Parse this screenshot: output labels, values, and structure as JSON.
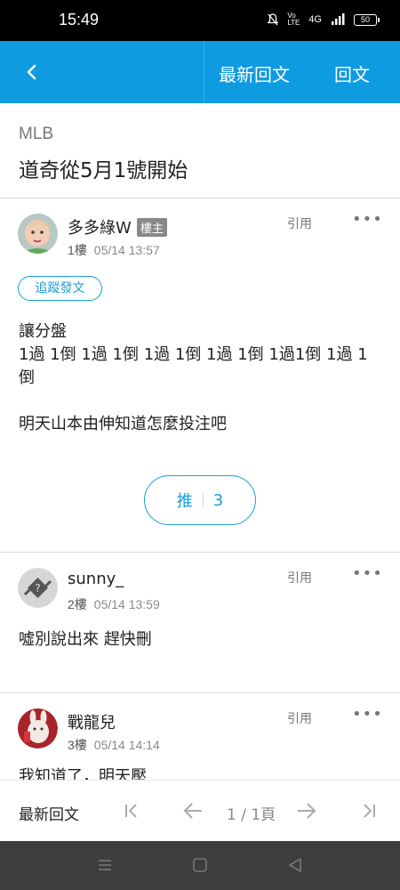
{
  "status_bar": {
    "time": "15:49",
    "network": "4G",
    "volte": "Vo LTE",
    "battery": "50"
  },
  "app_bar": {
    "latest_label": "最新回文",
    "reply_label": "回文"
  },
  "thread": {
    "board": "MLB",
    "title": "道奇從5月1號開始"
  },
  "posts": [
    {
      "author": "多多綠W",
      "badge": "樓主",
      "floor": "1樓",
      "time": "05/14 13:57",
      "quote_label": "引用",
      "follow_label": "追蹤發文",
      "lines": [
        "讓分盤",
        "1過 1倒 1過 1倒 1過 1倒 1過 1倒 1過1倒 1過 1",
        "倒",
        "",
        "明天山本由伸知道怎麼投注吧"
      ],
      "push_label": "推",
      "push_count": "3"
    },
    {
      "author": "sunny_",
      "floor": "2樓",
      "time": "05/14 13:59",
      "quote_label": "引用",
      "lines": [
        "噓別說出來 趕快刪"
      ]
    },
    {
      "author": "戰龍兒",
      "floor": "3樓",
      "time": "05/14 14:14",
      "quote_label": "引用",
      "lines": [
        "我知道了，明天壓"
      ]
    }
  ],
  "bottom_bar": {
    "latest_label": "最新回文",
    "pager": "1 / 1頁"
  },
  "colors": {
    "accent": "#0e9be0",
    "link": "#1a9fd9"
  },
  "icons": [
    "back-arrow-icon",
    "more-icon",
    "first-page-icon",
    "prev-page-icon",
    "next-page-icon",
    "last-page-icon",
    "menu-icon",
    "home-icon",
    "back-triangle-icon"
  ]
}
